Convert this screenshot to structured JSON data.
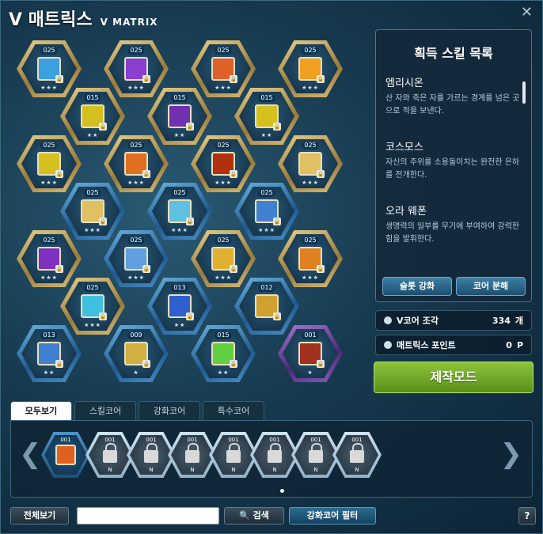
{
  "window": {
    "title": "V 매트릭스",
    "subtitle": "V MATRIX",
    "close_symbol": "✕"
  },
  "matrix": {
    "cores": [
      {
        "level": "025",
        "stars": "★★★",
        "color": "gold",
        "icon_color": "#3aa0e0",
        "locked": true
      },
      {
        "level": "025",
        "stars": "★★★",
        "color": "gold",
        "icon_color": "#8a3fd1",
        "locked": true
      },
      {
        "level": "025",
        "stars": "★★★",
        "color": "gold",
        "icon_color": "#e0602a",
        "locked": true
      },
      {
        "level": "025",
        "stars": "★★★",
        "color": "gold",
        "icon_color": "#f0a020",
        "locked": true
      },
      {
        "level": "015",
        "stars": "★★",
        "color": "gold",
        "icon_color": "#d6c020",
        "locked": true
      },
      {
        "level": "015",
        "stars": "★★",
        "color": "gold",
        "icon_color": "#7030b0",
        "locked": true
      },
      {
        "level": "015",
        "stars": "★★",
        "color": "gold",
        "icon_color": "#d6c020",
        "locked": true
      },
      {
        "level": "025",
        "stars": "★★★",
        "color": "gold",
        "icon_color": "#d6c020",
        "locked": true
      },
      {
        "level": "025",
        "stars": "★★★",
        "color": "gold",
        "icon_color": "#e07020",
        "locked": true
      },
      {
        "level": "025",
        "stars": "★★★",
        "color": "gold",
        "icon_color": "#b03010",
        "locked": true
      },
      {
        "level": "025",
        "stars": "★★★",
        "color": "gold",
        "icon_color": "#e0c060",
        "locked": true
      },
      {
        "level": "025",
        "stars": "★★★",
        "color": "blue",
        "icon_color": "#e0c060",
        "locked": true
      },
      {
        "level": "025",
        "stars": "★★★",
        "color": "blue",
        "icon_color": "#60c0e0",
        "locked": true
      },
      {
        "level": "025",
        "stars": "★★★",
        "color": "blue",
        "icon_color": "#4080d0",
        "locked": true
      },
      {
        "level": "025",
        "stars": "★★★",
        "color": "gold",
        "icon_color": "#8030c0",
        "locked": true
      },
      {
        "level": "025",
        "stars": "★★★",
        "color": "blue",
        "icon_color": "#60a0e0",
        "locked": true
      },
      {
        "level": "025",
        "stars": "★★★",
        "color": "gold",
        "icon_color": "#e0b030",
        "locked": true
      },
      {
        "level": "025",
        "stars": "★★★",
        "color": "gold",
        "icon_color": "#e08020",
        "locked": true
      },
      {
        "level": "025",
        "stars": "★★★",
        "color": "gold",
        "icon_color": "#40c0e0",
        "locked": true
      },
      {
        "level": "013",
        "stars": "★★",
        "color": "blue",
        "icon_color": "#3060d0",
        "locked": true
      },
      {
        "level": "012",
        "stars": "",
        "color": "blue",
        "icon_color": "#d0a030",
        "locked": true
      },
      {
        "level": "013",
        "stars": "★★",
        "color": "blue",
        "icon_color": "#4080d0",
        "locked": true
      },
      {
        "level": "009",
        "stars": "★",
        "color": "blue",
        "icon_color": "#d0b040",
        "locked": true
      },
      {
        "level": "015",
        "stars": "★★",
        "color": "blue",
        "icon_color": "#60d040",
        "locked": true
      },
      {
        "level": "001",
        "stars": "★",
        "color": "purple",
        "icon_color": "#a03020",
        "locked": true
      }
    ]
  },
  "skill_panel": {
    "title": "획득 스킬 목록",
    "skills": [
      {
        "name": "엠리시온",
        "desc": "산 자와 죽은 자를 가르는 경계를 넘은 곳으로 적을 보낸다."
      },
      {
        "name": "코스모스",
        "desc": "자신의 주위를 소용돌이치는 완전한 은하를 전개한다."
      },
      {
        "name": "오라 웨폰",
        "desc": "생명력의 일부를 무기에 부여하여 강력한 힘을 발휘한다."
      }
    ],
    "slot_enhance_label": "슬롯 강화",
    "core_disassemble_label": "코어 분해"
  },
  "stats": {
    "v_core_label": "V코어 조각",
    "v_core_value": "334",
    "v_core_unit": "개",
    "matrix_point_label": "매트릭스 포인트",
    "matrix_point_value": "0",
    "matrix_point_unit": "P"
  },
  "craft_label": "제작모드",
  "tabs": [
    "모두보기",
    "스킬코어",
    "강화코어",
    "특수코어"
  ],
  "inventory": {
    "first_level": "001",
    "locked_levels": [
      "001",
      "001",
      "001",
      "001",
      "001",
      "001",
      "001"
    ],
    "locked_tag": "N",
    "left_arrow": "❮",
    "right_arrow": "❯"
  },
  "bottom": {
    "view_all_label": "전체보기",
    "search_value": "",
    "search_label": "🔍 검색",
    "filter_label": "강화코어 필터",
    "help_label": "?"
  }
}
